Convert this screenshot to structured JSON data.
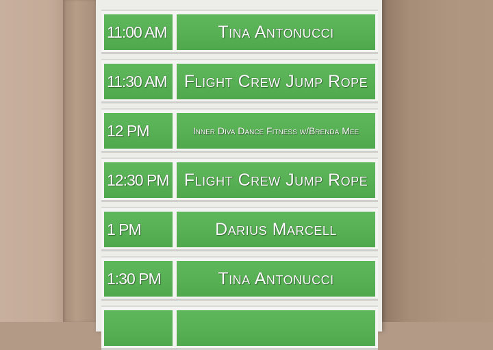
{
  "schedule": {
    "rows": [
      {
        "time": "11:00 AM",
        "event": "Tina Antonucci"
      },
      {
        "time": "11:30 AM",
        "event": "Flight Crew Jump Rope"
      },
      {
        "time": "12 PM",
        "event": "Inner Diva Dance Fitness w/Brenda Mee"
      },
      {
        "time": "12:30 PM",
        "event": "Flight Crew Jump Rope"
      },
      {
        "time": "1 PM",
        "event": "Darius Marcell"
      },
      {
        "time": "1:30 PM",
        "event": "Tina Antonucci"
      }
    ]
  },
  "colors": {
    "card_green": "#58b155",
    "board": "#ededea",
    "wall": "#b29a86"
  }
}
